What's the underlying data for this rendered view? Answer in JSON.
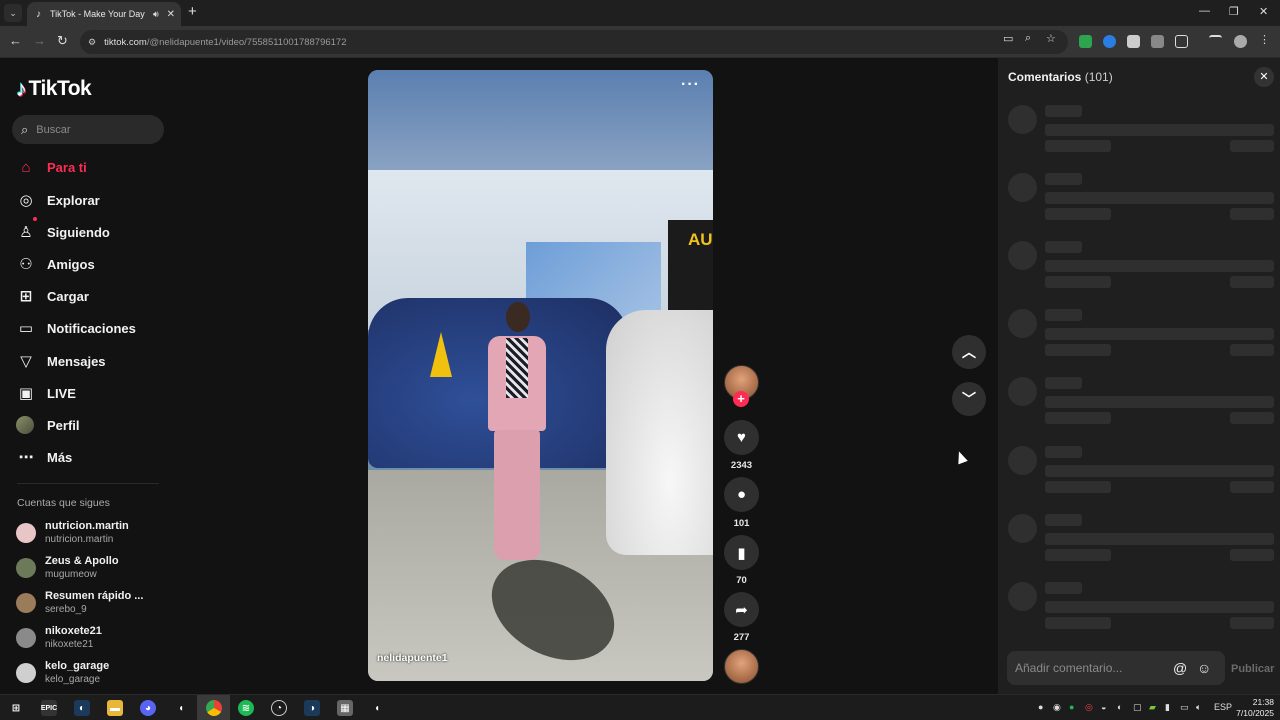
{
  "browser": {
    "tab_title": "TikTok - Make Your Day",
    "url_host": "tiktok.com",
    "url_path": "/@nelidapuente1/video/7558511001788796172",
    "tab_audio_icon": "speaker-icon",
    "new_tab": "+"
  },
  "sidebar": {
    "logo_text": "TikTok",
    "search_placeholder": "Buscar",
    "nav": [
      {
        "label": "Para ti",
        "icon": "home-icon"
      },
      {
        "label": "Explorar",
        "icon": "compass-icon"
      },
      {
        "label": "Siguiendo",
        "icon": "user-follow-icon"
      },
      {
        "label": "Amigos",
        "icon": "friends-icon"
      },
      {
        "label": "Cargar",
        "icon": "upload-icon"
      },
      {
        "label": "Notificaciones",
        "icon": "inbox-icon"
      },
      {
        "label": "Mensajes",
        "icon": "send-icon"
      },
      {
        "label": "LIVE",
        "icon": "live-icon"
      },
      {
        "label": "Perfil",
        "icon": "avatar"
      },
      {
        "label": "Más",
        "icon": "more-icon"
      }
    ],
    "following_title": "Cuentas que sigues",
    "following": [
      {
        "name": "nutricion.martin",
        "handle": "nutricion.martin"
      },
      {
        "name": "Zeus & Apollo",
        "handle": "mugumeow"
      },
      {
        "name": "Resumen rápido ...",
        "handle": "serebo_9"
      },
      {
        "name": "nikoxete21",
        "handle": "nikoxete21"
      },
      {
        "name": "kelo_garage",
        "handle": "kelo_garage"
      }
    ]
  },
  "video": {
    "username": "nelidapuente1",
    "sign_text": "AU",
    "likes": "2343",
    "comments": "101",
    "saves": "70",
    "shares": "277"
  },
  "comments_panel": {
    "title": "Comentarios",
    "count": "(101)",
    "input_placeholder": "Añadir comentario...",
    "post_label": "Publicar",
    "mention_icon": "@",
    "emoji_icon": "☺"
  },
  "taskbar": {
    "language": "ESP",
    "time": "21:38",
    "date": "7/10/2025"
  }
}
